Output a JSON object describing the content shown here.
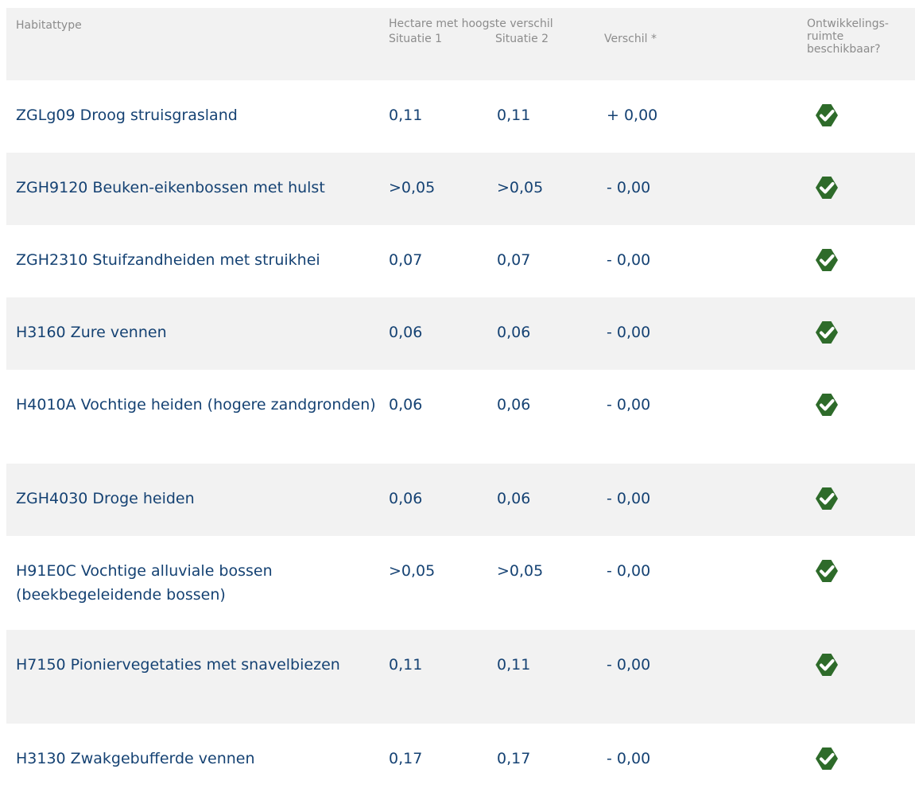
{
  "header": {
    "habitat": "Habitattype",
    "hectare": "Hectare met hoogste verschil",
    "situatie1": "Situatie 1",
    "situatie2": "Situatie 2",
    "verschil": "Verschil *",
    "ontwikkeling": "Ontwikkelings-\nruimte\nbeschikbaar?"
  },
  "rows": [
    {
      "name": "ZGLg09 Droog struisgrasland",
      "s1": "0,11",
      "s2": "0,11",
      "diff": "+ 0,00",
      "available": true
    },
    {
      "name": "ZGH9120 Beuken-eikenbossen met hulst",
      "s1": ">0,05",
      "s2": ">0,05",
      "diff": "- 0,00",
      "available": true
    },
    {
      "name": "ZGH2310 Stuifzandheiden met struikhei",
      "s1": "0,07",
      "s2": "0,07",
      "diff": "- 0,00",
      "available": true
    },
    {
      "name": "H3160 Zure vennen",
      "s1": "0,06",
      "s2": "0,06",
      "diff": "- 0,00",
      "available": true
    },
    {
      "name": "H4010A Vochtige heiden (hogere zandgronden)",
      "s1": "0,06",
      "s2": "0,06",
      "diff": "- 0,00",
      "available": true
    },
    {
      "name": "ZGH4030 Droge heiden",
      "s1": "0,06",
      "s2": "0,06",
      "diff": "- 0,00",
      "available": true
    },
    {
      "name": "H91E0C Vochtige alluviale bossen (beekbegeleidende bossen)",
      "s1": ">0,05",
      "s2": ">0,05",
      "diff": "- 0,00",
      "available": true
    },
    {
      "name": "H7150 Pioniervegetaties met snavelbiezen",
      "s1": "0,11",
      "s2": "0,11",
      "diff": "- 0,00",
      "available": true
    },
    {
      "name": "H3130 Zwakgebufferde vennen",
      "s1": "0,17",
      "s2": "0,17",
      "diff": "- 0,00",
      "available": true
    }
  ],
  "colors": {
    "text": "#154273",
    "header_text": "#8c8c8c",
    "stripe": "#f2f2f2",
    "check": "#2e6b2a"
  },
  "icons": {
    "available": "check-circle-icon"
  }
}
